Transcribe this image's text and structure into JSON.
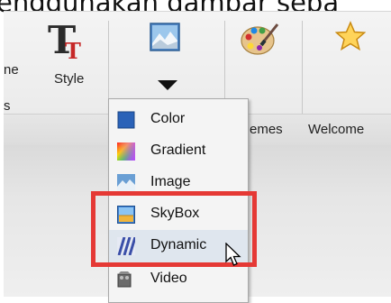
{
  "caption": "enggunakan gambar seba",
  "toolbar": {
    "left_label_top": "ne",
    "left_label_bottom": "s",
    "style_label": "Style",
    "themes_label": "emes",
    "welcome_label": "Welcome",
    "icons": [
      "text-style-icon",
      "background-image-icon",
      "palette-icon",
      "star-icon"
    ]
  },
  "menu": {
    "items": [
      {
        "label": "Color",
        "icon": "color-square-icon"
      },
      {
        "label": "Gradient",
        "icon": "gradient-icon"
      },
      {
        "label": "Image",
        "icon": "image-icon"
      },
      {
        "label": "SkyBox",
        "icon": "skybox-icon"
      },
      {
        "label": "Dynamic",
        "icon": "dynamic-stripes-icon"
      },
      {
        "label": "Video",
        "icon": "video-icon"
      }
    ],
    "hovered": "Dynamic"
  },
  "colors": {
    "highlight": "#e53935",
    "menu_bg": "#f4f4f4"
  }
}
